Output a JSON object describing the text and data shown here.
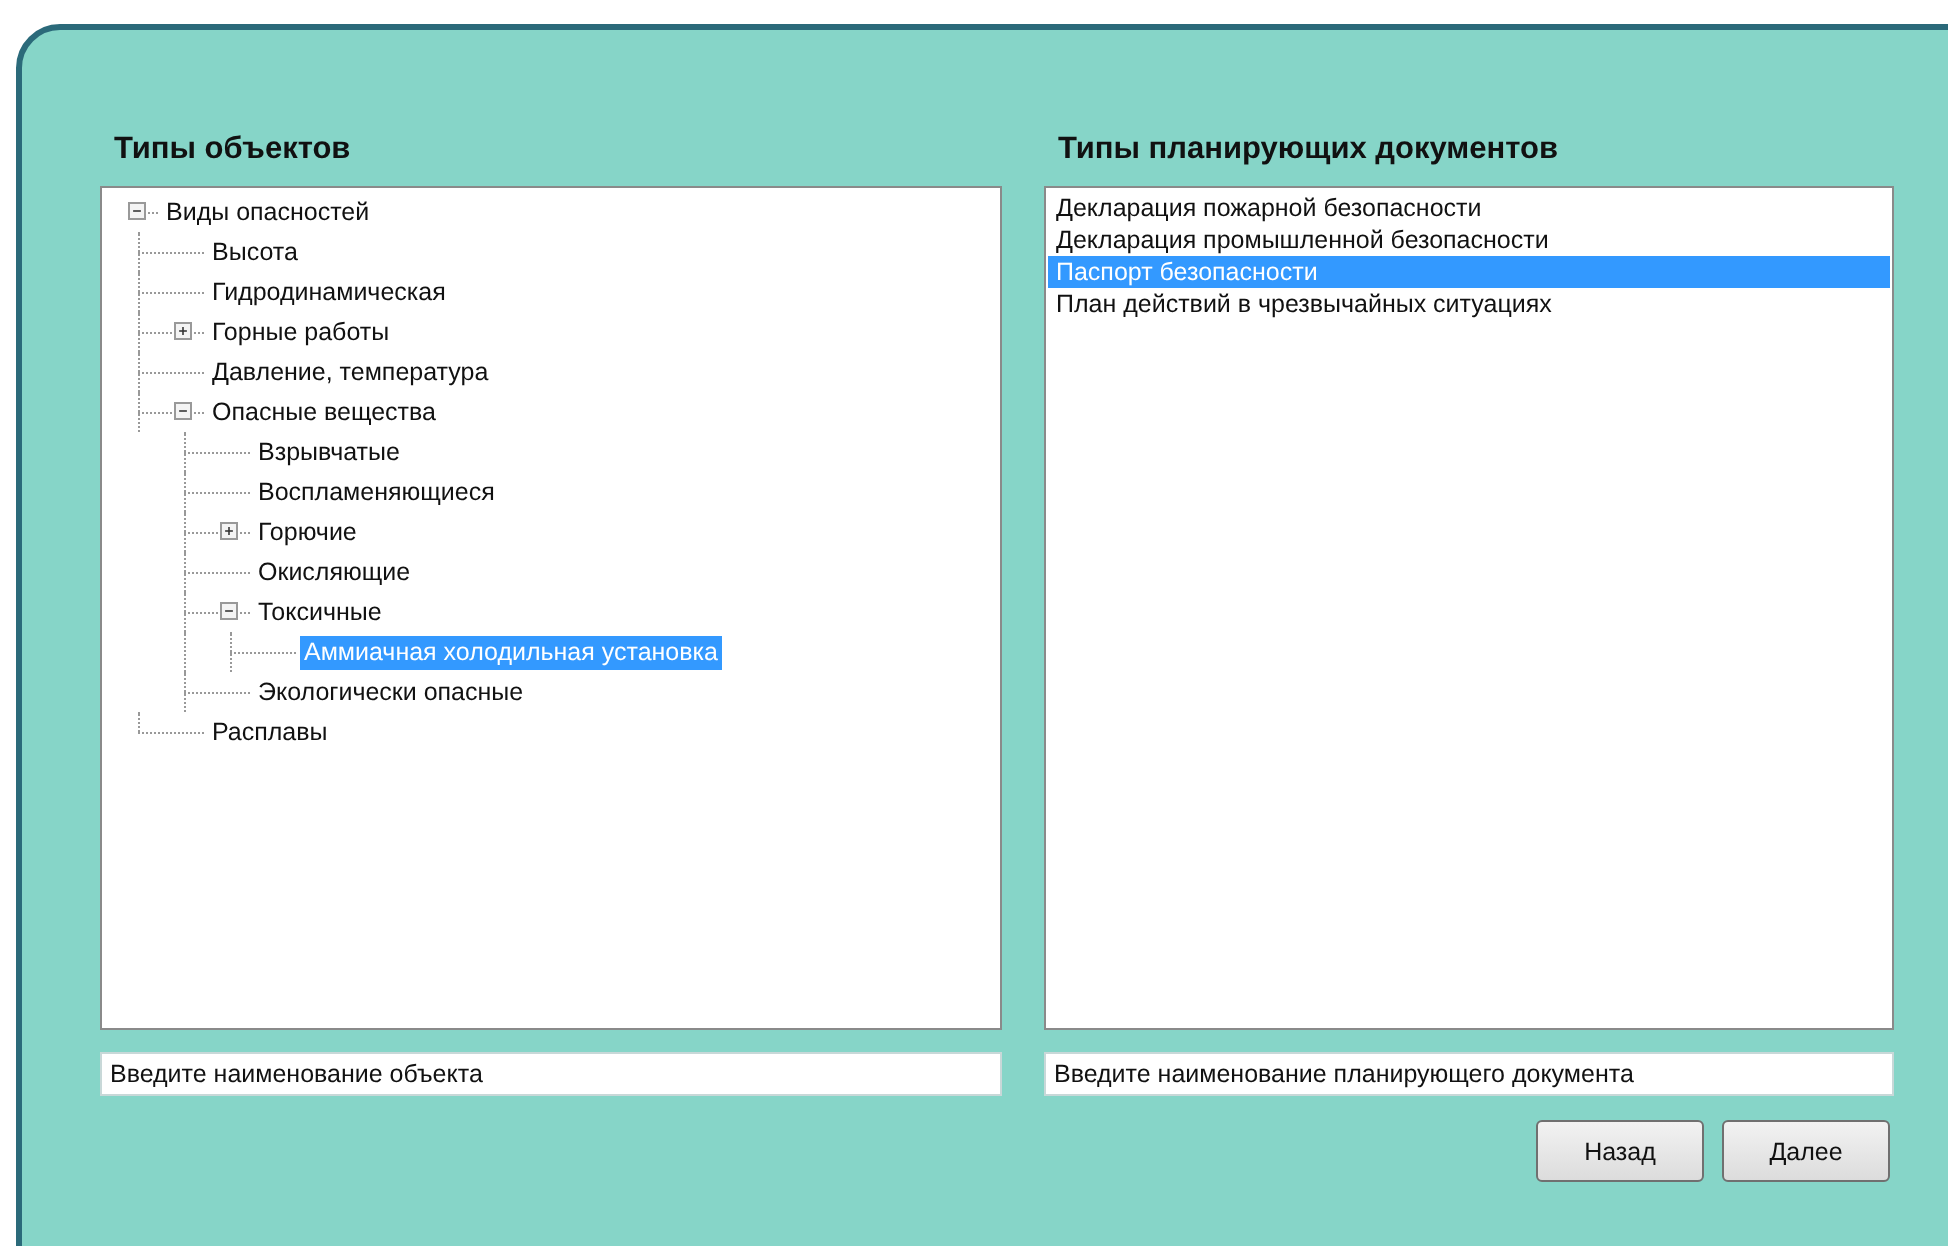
{
  "left_panel": {
    "title": "Типы объектов",
    "tree": [
      {
        "label": "Виды опасностей",
        "expanded": true,
        "selected": false,
        "children": [
          {
            "label": "Высота",
            "selected": false
          },
          {
            "label": "Гидродинамическая",
            "selected": false
          },
          {
            "label": "Горные работы",
            "expanded": false,
            "selected": false
          },
          {
            "label": "Давление, температура",
            "selected": false
          },
          {
            "label": "Опасные вещества",
            "expanded": true,
            "selected": false,
            "children": [
              {
                "label": "Взрывчатые",
                "selected": false
              },
              {
                "label": "Воспламеняющиеся",
                "selected": false
              },
              {
                "label": "Горючие",
                "expanded": false,
                "selected": false
              },
              {
                "label": "Окисляющие",
                "selected": false
              },
              {
                "label": "Токсичные",
                "expanded": true,
                "selected": false,
                "children": [
                  {
                    "label": "Аммиачная холодильная установка",
                    "selected": true
                  }
                ]
              },
              {
                "label": "Экологически опасные",
                "selected": false
              }
            ]
          },
          {
            "label": "Расплавы",
            "selected": false
          }
        ]
      }
    ],
    "field": {
      "value": "Введите наименование объекта"
    }
  },
  "right_panel": {
    "title": "Типы планирующих документов",
    "list": [
      {
        "label": "Декларация пожарной безопасности",
        "selected": false
      },
      {
        "label": "Декларация промышленной безопасности",
        "selected": false
      },
      {
        "label": "Паспорт безопасности",
        "selected": true
      },
      {
        "label": "План действий в чрезвычайных ситуациях",
        "selected": false
      }
    ],
    "field": {
      "value": "Введите наименование планирующего документа"
    }
  },
  "buttons": [
    "Назад",
    "Далее"
  ]
}
